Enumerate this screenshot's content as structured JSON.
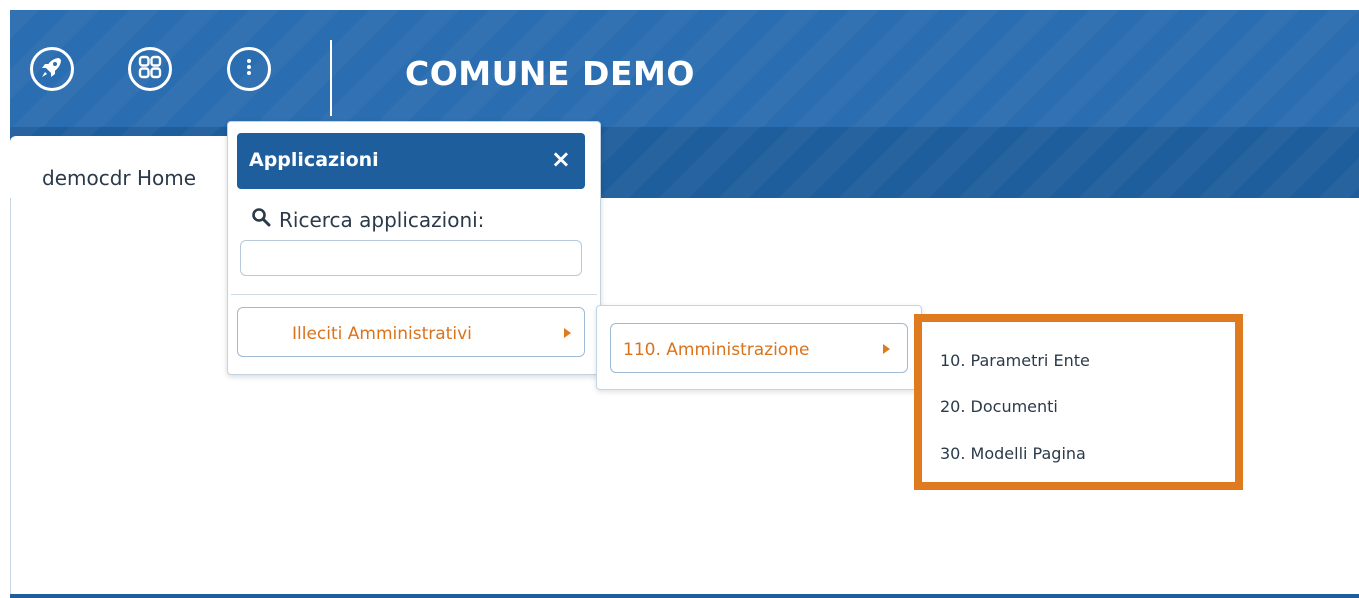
{
  "header": {
    "title": "COMUNE DEMO",
    "buttons": [
      {
        "name": "rocket-icon"
      },
      {
        "name": "apps-grid-icon"
      },
      {
        "name": "more-vertical-icon"
      }
    ]
  },
  "tabs": [
    {
      "label": "democdr Home"
    }
  ],
  "apps_popup": {
    "title": "Applicazioni",
    "close_label": "×",
    "search_label": "Ricerca applicazioni:",
    "search_value": "",
    "items": [
      {
        "label": "Illeciti Amministrativi"
      }
    ]
  },
  "submenu_level1": {
    "items": [
      {
        "label": "110. Amministrazione"
      }
    ]
  },
  "submenu_level2": {
    "highlight_color": "#e07a1f",
    "items": [
      {
        "label": "10. Parametri Ente"
      },
      {
        "label": "20. Documenti"
      },
      {
        "label": "30. Modelli Pagina"
      }
    ]
  },
  "colors": {
    "header_blue": "#2a6db0",
    "tabstrip_blue": "#1f5e9c",
    "menu_orange": "#d9731c"
  }
}
